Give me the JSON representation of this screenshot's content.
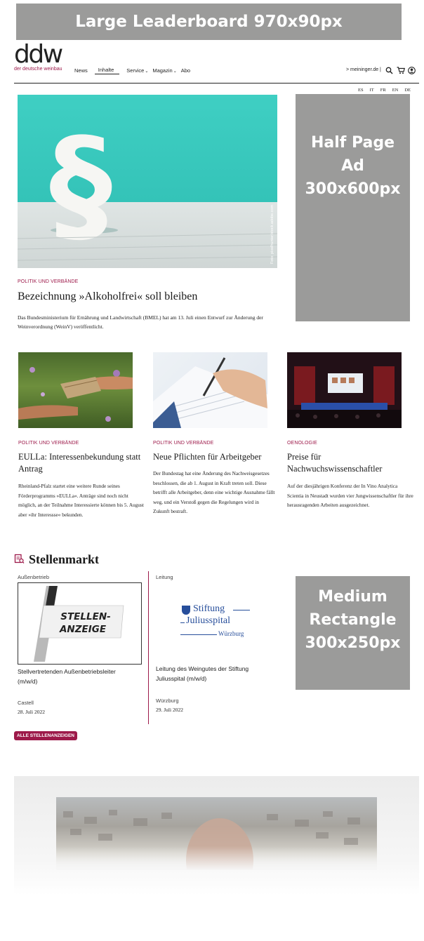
{
  "ads": {
    "leaderboard": "Large Leaderboard 970x90px",
    "half_page": "Half Page Ad 300x600px",
    "medium_rect": "Medium Rectangle 300x250px"
  },
  "header": {
    "logo": "ddw",
    "logo_sub": "der deutsche weinbau",
    "nav": [
      "News",
      "Inhalte",
      "Service",
      "Magazin",
      "Abo"
    ],
    "meininger_link": "> meininger.de |",
    "languages": [
      "ES",
      "IT",
      "FR",
      "EN",
      "DE"
    ]
  },
  "hero": {
    "photo_credit": "Foto: pixelhunter/stock.adobe.com",
    "kicker": "POLITIK UND VERBÄNDE",
    "title": "Bezeichnung »Alkoholfrei« soll bleiben",
    "teaser": "Das Bundesministerium für Ernährung und Landwirtschaft (BMEL) hat am 13. Juli einen Entwurf zur Änderung der Weinverordnung (WeinV) veröffentlicht."
  },
  "articles": [
    {
      "kicker": "POLITIK UND VERBÄNDE",
      "title": "EULLa: Interessenbekundung statt Antrag",
      "teaser": "Rheinland-Pfalz startet eine weitere Runde seines Förderprogramms »EULLa«. Anträge sind noch nicht möglich, an der Teilnahme Interessierte können bis 5. August aber »ihr Interessse« bekunden."
    },
    {
      "kicker": "POLITIK UND VERBÄNDE",
      "title": "Neue Pflichten für Arbeitgeber",
      "teaser": "Der Bundestag hat eine Änderung des Nachweisgesetzes beschlossen, die ab 1. August in Kraft treten soll. Diese betrifft alle Arbeitgeber, denn eine wichtige Ausnahme fällt weg, und ein Verstoß gegen die Regelungen wird in Zukunft bestraft."
    },
    {
      "kicker": "OENOLOGIE",
      "title": "Preise für Nachwuchswissenschaftler",
      "teaser": "Auf der diesjährigen Konferenz der In Vino Analytica Scientia in Neustadt wurden vier Jungwissenschaftler für ihre herausragenden Arbeiten ausgezeichnet."
    }
  ],
  "stellenmarkt": {
    "heading": "Stellenmarkt",
    "jobs": [
      {
        "category": "Außenbetrieb",
        "logo_text": "STELLEN-\nANZEIGE",
        "title": "Stellvertretenden Außenbetriebsleiter (m/w/d)",
        "location": "Castell",
        "date": "28. Juli 2022"
      },
      {
        "category": "Leitung",
        "logo_line1": "Stiftung",
        "logo_line2": "Juliusspital",
        "logo_line3": "Würzburg",
        "title": "Leitung des Weingutes der Stiftung Juliusspital (m/w/d)",
        "location": "Würzburg",
        "date": "29. Juli 2022"
      }
    ],
    "all_button": "ALLE STELLENANZEIGEN"
  },
  "colors": {
    "accent": "#9d1a4a",
    "ad_gray": "#9b9b9a",
    "hero_teal": "#35c6bb"
  }
}
